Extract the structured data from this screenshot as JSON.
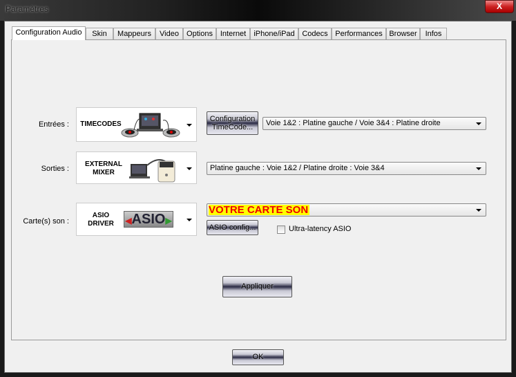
{
  "window": {
    "title": "Paramètres",
    "close_label": "X"
  },
  "tabs": [
    {
      "label": "Configuration Audio"
    },
    {
      "label": "Skin"
    },
    {
      "label": "Mappeurs"
    },
    {
      "label": "Video"
    },
    {
      "label": "Options"
    },
    {
      "label": "Internet"
    },
    {
      "label": "iPhone/iPad"
    },
    {
      "label": "Codecs"
    },
    {
      "label": "Performances"
    },
    {
      "label": "Browser"
    },
    {
      "label": "Infos"
    }
  ],
  "inputs": {
    "label": "Entrées :",
    "image_text": "TIMECODES",
    "config_button": "Configuration TimeCode...",
    "routing": "Voie 1&2 : Platine gauche / Voie 3&4 : Platine droite"
  },
  "outputs": {
    "label": "Sorties :",
    "image_text_1": "EXTERNAL",
    "image_text_2": "MIXER",
    "routing": "Platine gauche : Voie 1&2 / Platine droite : Voie 3&4"
  },
  "soundcard": {
    "label": "Carte(s) son :",
    "image_text_1": "ASIO",
    "image_text_2": "DRIVER",
    "logo_text": "ASIO",
    "selected": "VOTRE CARTE SON",
    "config_button": "ASIO config...",
    "ultra_latency_label": "Ultra-latency ASIO",
    "ultra_latency_checked": false
  },
  "apply_label": "Appliquer",
  "ok_label": "OK"
}
